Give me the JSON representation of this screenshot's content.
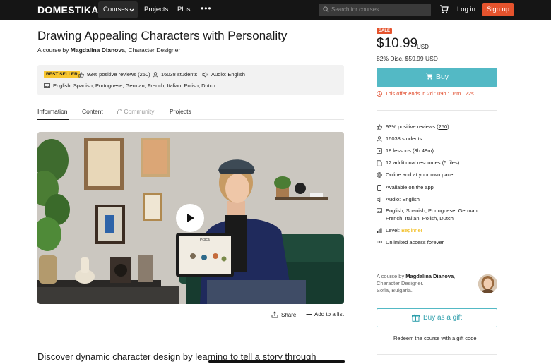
{
  "nav": {
    "logo": "DOMESTIKA",
    "courses": "Courses",
    "projects": "Projects",
    "plus": "Plus",
    "more": "•••",
    "search_placeholder": "Search for courses",
    "login": "Log in",
    "signup": "Sign up"
  },
  "course": {
    "title": "Drawing Appealing Characters with Personality",
    "byline_prefix": "A course by",
    "author_name": "Magdalina Dianova",
    "byline_suffix": ", Character Designer"
  },
  "infobox": {
    "badge": "BEST SELLER",
    "reviews": "93% positive reviews (250)",
    "students": "16038 students",
    "audio": "Audio: English",
    "languages": "English, Spanish, Portuguese, German, French, Italian, Polish, Dutch"
  },
  "tabs": [
    {
      "label": "Information"
    },
    {
      "label": "Content"
    },
    {
      "label": "Community"
    },
    {
      "label": "Projects"
    }
  ],
  "video": {
    "tablet_text": "Pcsca"
  },
  "actions": {
    "share": "Share",
    "add_to_list": "Add to a list"
  },
  "description_heading": "Discover dynamic character design by learning to tell a story through",
  "purchase": {
    "sale_badge": "SALE",
    "price": "$10.99",
    "currency": "USD",
    "discount": "82% Disc.",
    "old_price": "$59.99 USD",
    "buy_label": "Buy",
    "offer": "This offer ends in 2d : 09h : 06m : 22s"
  },
  "features": {
    "reviews_prefix": "93% positive reviews (",
    "reviews_count": "250",
    "reviews_suffix": ")",
    "students": "16038 students",
    "lessons": "18 lessons (3h 48m)",
    "resources": "12 additional resources (5 files)",
    "online": "Online and at your own pace",
    "app": "Available on the app",
    "audio": "Audio: English",
    "languages": "English, Spanish, Portuguese, German, French, Italian, Polish, Dutch",
    "level_label": "Level:",
    "level_value": "Beginner",
    "access": "Unlimited access forever"
  },
  "author_card": {
    "prefix": "A course by",
    "name": "Magdalina Dianova",
    "role": "Character Designer.",
    "location": "Sofia, Bulgaria."
  },
  "gift": {
    "button": "Buy as a gift",
    "redeem": "Redeem the course with a gift code"
  },
  "colors": {
    "accent_teal": "#53b9c5",
    "brand_orange": "#e5532d",
    "badge_yellow": "#f8c630",
    "nav_bg": "#151515"
  }
}
